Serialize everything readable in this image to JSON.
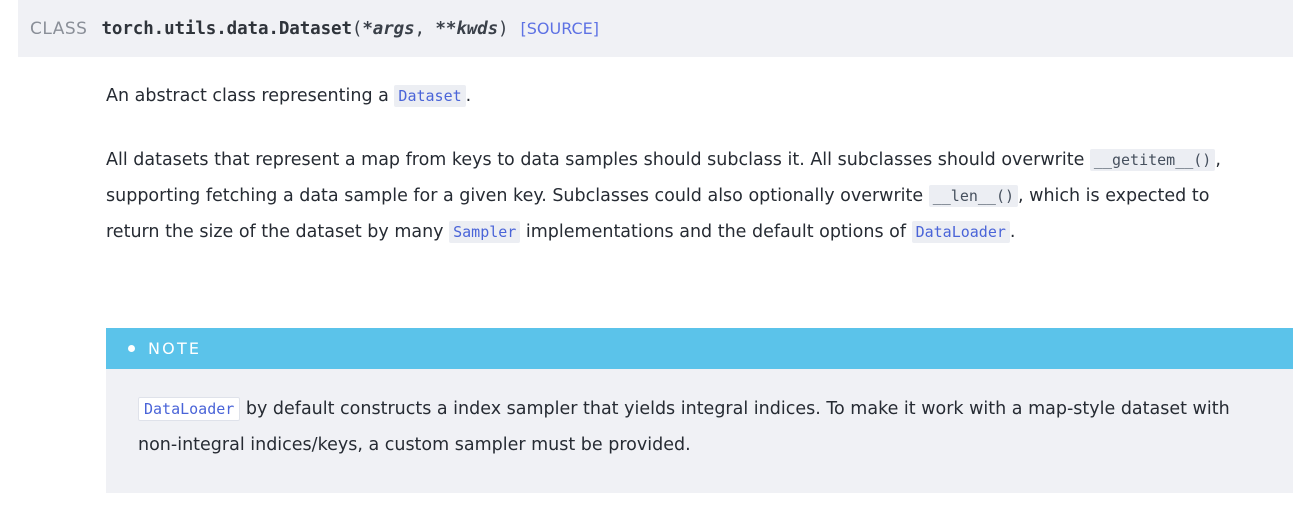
{
  "signature": {
    "kind_label": "CLASS",
    "qualified_name": "torch.utils.data.Dataset",
    "open_paren": "(",
    "params": [
      {
        "text": "*args",
        "separator": ", "
      },
      {
        "text": "**kwds",
        "separator": ""
      }
    ],
    "close_paren": ")",
    "source_link_label": "[SOURCE]",
    "source_link_color": "#5e72e4",
    "background_color": "#f0f1f5"
  },
  "body": {
    "paragraph_1": {
      "part_1": "An abstract class representing a ",
      "code_1": "Dataset",
      "part_2": "."
    },
    "paragraph_2": {
      "part_1": "All datasets that represent a map from keys to data samples should subclass it. All subclasses should overwrite ",
      "code_1": "__getitem__()",
      "part_2": ", supporting fetching a data sample for a given key. Subclasses could also optionally overwrite ",
      "code_2": "__len__()",
      "part_3": ", which is expected to return the size of the dataset by many ",
      "code_3": "Sampler",
      "part_4": " implementations and the default options of ",
      "code_4": "DataLoader",
      "part_5": "."
    }
  },
  "note": {
    "title": "NOTE",
    "title_background_color": "#5bc3ea",
    "body_background_color": "#f0f1f5",
    "bullet_icon": "bullet-dot-icon",
    "text": {
      "code_1": "DataLoader",
      "part_1": " by default constructs a index sampler that yields integral indices. To make it work with a map-style dataset with non-integral indices/keys, a custom sampler must be provided."
    }
  }
}
